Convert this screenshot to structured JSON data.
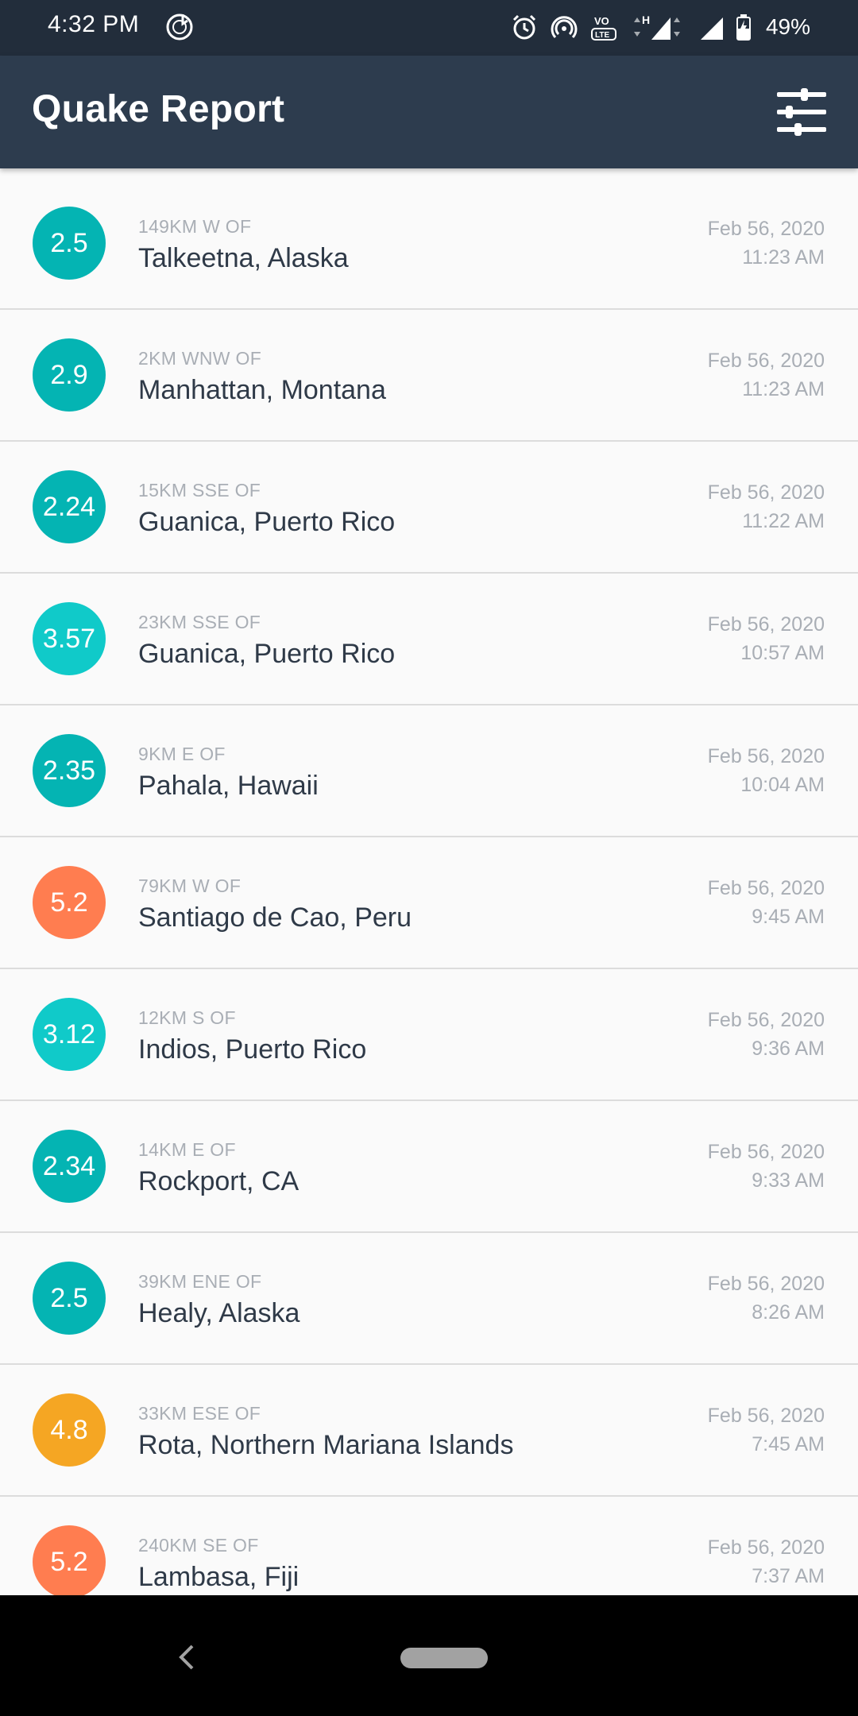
{
  "status_bar": {
    "time": "4:32 PM",
    "battery": "49%",
    "icons": [
      "music-note-icon",
      "alarm-icon",
      "hotspot-icon",
      "volte-icon",
      "signal-h-icon",
      "signal-icon",
      "battery-icon"
    ]
  },
  "app_bar": {
    "title": "Quake Report",
    "settings_icon": "filter-settings-icon"
  },
  "earthquakes": [
    {
      "mag": "2.5",
      "color": "#04b4b3",
      "offset": "149km W of",
      "place": "Talkeetna, Alaska",
      "date": "Feb 56, 2020",
      "time": "11:23 AM"
    },
    {
      "mag": "2.9",
      "color": "#04b4b3",
      "offset": "2km WNW of",
      "place": "Manhattan, Montana",
      "date": "Feb 56, 2020",
      "time": "11:23 AM"
    },
    {
      "mag": "2.24",
      "color": "#04b4b3",
      "offset": "15km SSE of",
      "place": "Guanica, Puerto Rico",
      "date": "Feb 56, 2020",
      "time": "11:22 AM"
    },
    {
      "mag": "3.57",
      "color": "#10cac9",
      "offset": "23km SSE of",
      "place": "Guanica, Puerto Rico",
      "date": "Feb 56, 2020",
      "time": "10:57 AM"
    },
    {
      "mag": "2.35",
      "color": "#04b4b3",
      "offset": "9km E of",
      "place": "Pahala, Hawaii",
      "date": "Feb 56, 2020",
      "time": "10:04 AM"
    },
    {
      "mag": "5.2",
      "color": "#ff7d50",
      "offset": "79km W of",
      "place": "Santiago de Cao, Peru",
      "date": "Feb 56, 2020",
      "time": "9:45 AM"
    },
    {
      "mag": "3.12",
      "color": "#10cac9",
      "offset": "12km S of",
      "place": "Indios, Puerto Rico",
      "date": "Feb 56, 2020",
      "time": "9:36 AM"
    },
    {
      "mag": "2.34",
      "color": "#04b4b3",
      "offset": "14km E of",
      "place": "Rockport, CA",
      "date": "Feb 56, 2020",
      "time": "9:33 AM"
    },
    {
      "mag": "2.5",
      "color": "#04b4b3",
      "offset": "39km ENE of",
      "place": "Healy, Alaska",
      "date": "Feb 56, 2020",
      "time": "8:26 AM"
    },
    {
      "mag": "4.8",
      "color": "#f5a623",
      "offset": "33km ESE of",
      "place": "Rota, Northern Mariana Islands",
      "date": "Feb 56, 2020",
      "time": "7:45 AM"
    },
    {
      "mag": "5.2",
      "color": "#ff7d50",
      "offset": "240km SE of",
      "place": "Lambasa, Fiji",
      "date": "Feb 56, 2020",
      "time": "7:37 AM"
    }
  ],
  "nav_bar": {
    "icons": [
      "back-icon",
      "home-pill-icon"
    ]
  }
}
